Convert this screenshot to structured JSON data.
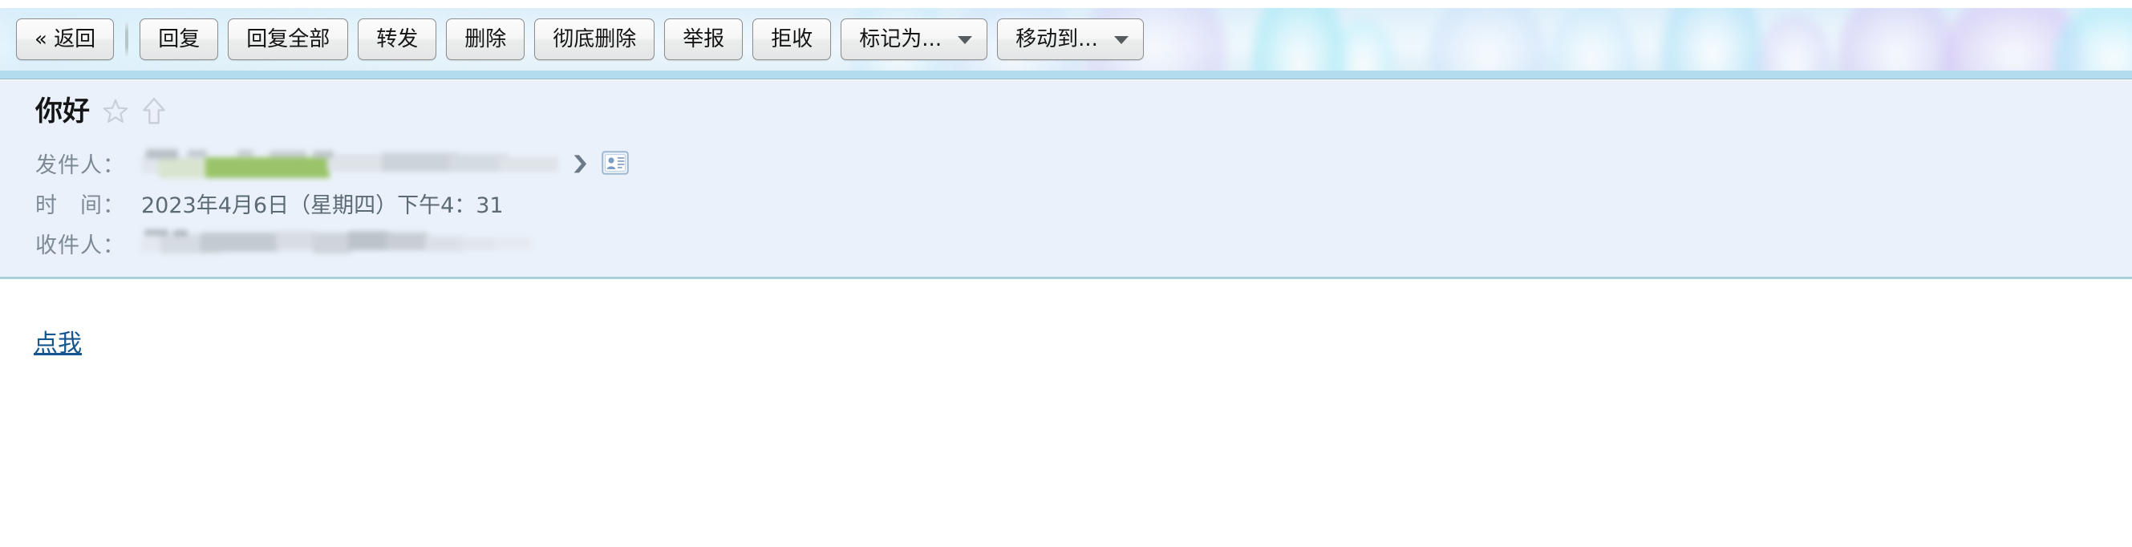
{
  "toolbar": {
    "buttons": [
      {
        "label": "« 返回",
        "name": "back-button",
        "caret": false
      },
      {
        "label": "回复",
        "name": "reply-button",
        "caret": false
      },
      {
        "label": "回复全部",
        "name": "reply-all-button",
        "caret": false
      },
      {
        "label": "转发",
        "name": "forward-button",
        "caret": false
      },
      {
        "label": "删除",
        "name": "delete-button",
        "caret": false
      },
      {
        "label": "彻底删除",
        "name": "delete-permanently-button",
        "caret": false
      },
      {
        "label": "举报",
        "name": "report-button",
        "caret": false
      },
      {
        "label": "拒收",
        "name": "reject-button",
        "caret": false
      },
      {
        "label": "标记为...",
        "name": "mark-as-dropdown",
        "caret": true
      },
      {
        "label": "移动到...",
        "name": "move-to-dropdown",
        "caret": true
      }
    ]
  },
  "mail": {
    "subject": "你好",
    "star_icon": "star-icon",
    "flag_icon": "up-arrow-icon",
    "fields": {
      "from_label": "发件人：",
      "from_value": "",
      "date_label": "时　间：",
      "date_value": "2023年4月6日（星期四）下午4：31",
      "to_label": "收件人：",
      "to_value": ""
    },
    "contact_card_icon": "contact-card-icon",
    "expand_icon": "chevron-right-icon"
  },
  "body": {
    "link_text": "点我"
  },
  "colors": {
    "toolbar_top": "#dceefa",
    "toolbar_bottom": "#e3f0f8",
    "toolbar_underline": "#b3dcee",
    "header_panel": "#eaf1fa",
    "header_border": "#a9cfd9",
    "link": "#15568f",
    "label_text": "#7d8a95",
    "value_text": "#5c6a74",
    "subject_text": "#151515",
    "redaction_green": "#9ac469",
    "redaction_gray": "#c9cfd4",
    "button_border": "#8d8d8d"
  }
}
